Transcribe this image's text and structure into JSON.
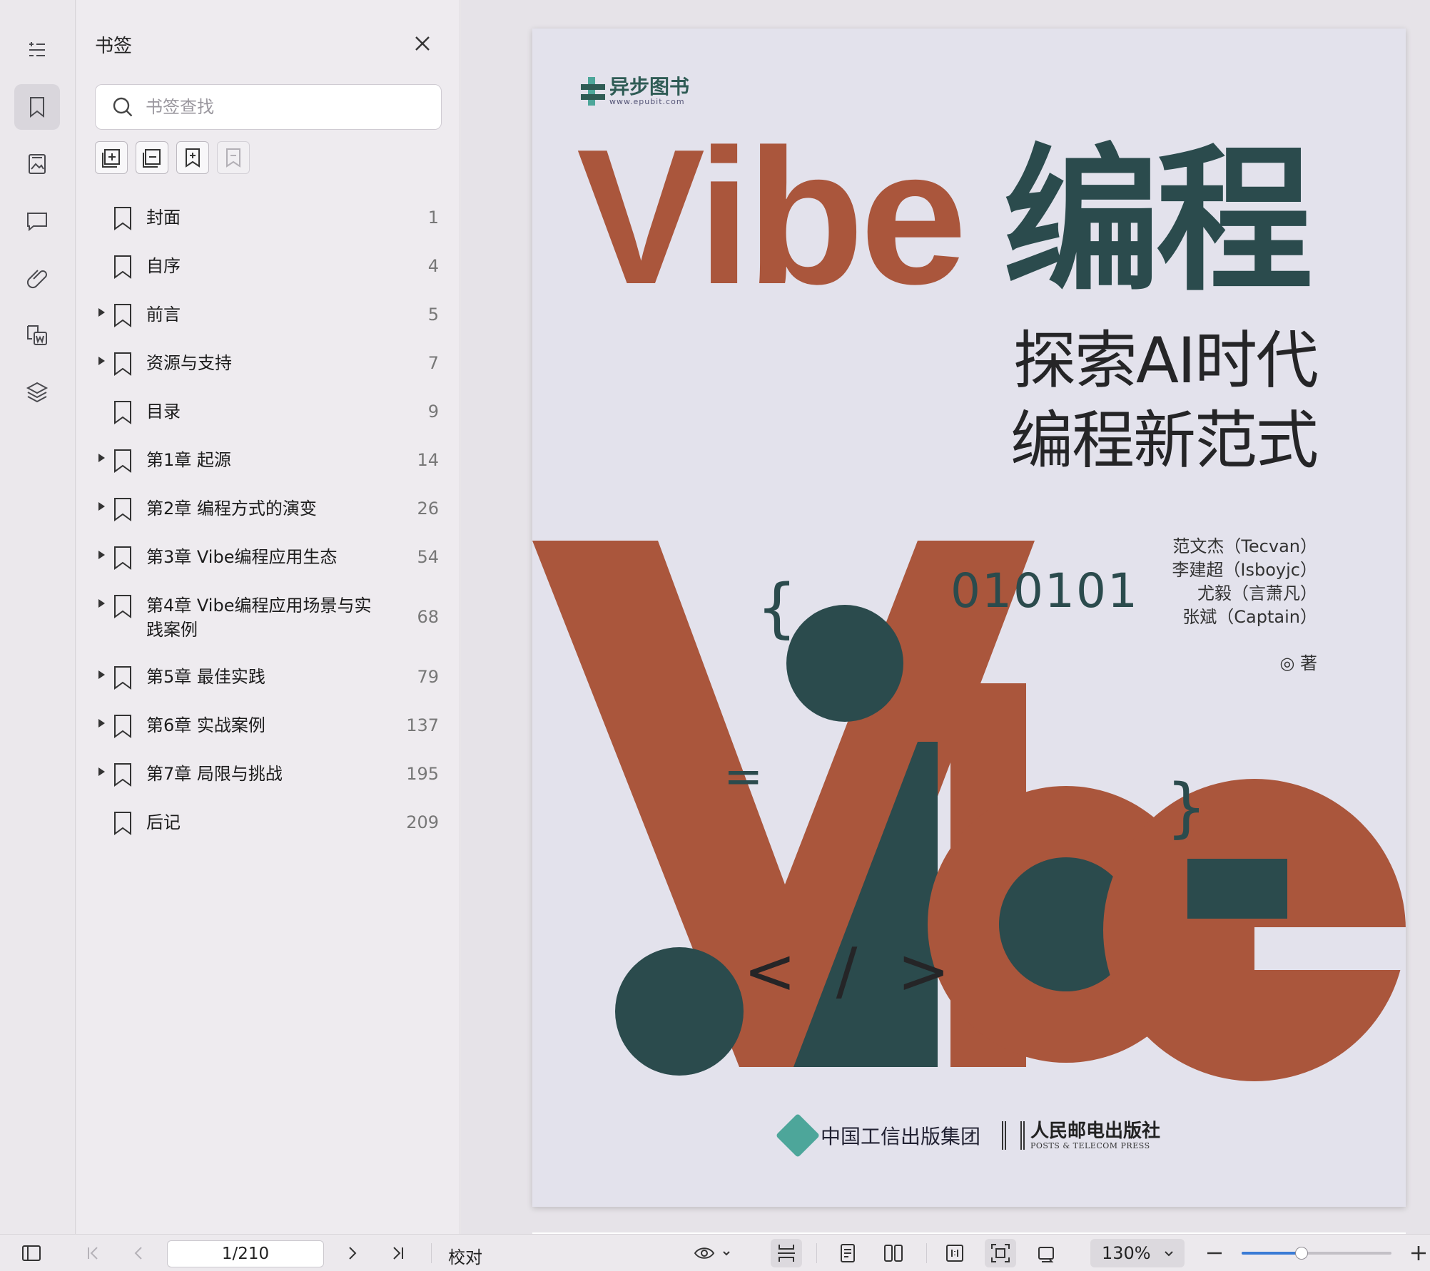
{
  "rail": {
    "items": [
      {
        "name": "outline-icon"
      },
      {
        "name": "bookmark-icon",
        "active": true
      },
      {
        "name": "thumbnail-icon"
      },
      {
        "name": "comment-icon"
      },
      {
        "name": "attachment-icon"
      },
      {
        "name": "pdf-to-word-icon"
      },
      {
        "name": "layers-icon"
      }
    ]
  },
  "bookmark_panel": {
    "title": "书签",
    "search_placeholder": "书签查找",
    "items": [
      {
        "label": "封面",
        "page": "1",
        "expandable": false
      },
      {
        "label": "自序",
        "page": "4",
        "expandable": false
      },
      {
        "label": "前言",
        "page": "5",
        "expandable": true
      },
      {
        "label": "资源与支持",
        "page": "7",
        "expandable": true
      },
      {
        "label": "目录",
        "page": "9",
        "expandable": false
      },
      {
        "label": "第1章 起源",
        "page": "14",
        "expandable": true
      },
      {
        "label": "第2章 编程方式的演变",
        "page": "26",
        "expandable": true
      },
      {
        "label": "第3章 Vibe编程应用生态",
        "page": "54",
        "expandable": true
      },
      {
        "label": "第4章 Vibe编程应用场景与实践案例",
        "page": "68",
        "expandable": true,
        "tall": true
      },
      {
        "label": "第5章 最佳实践",
        "page": "79",
        "expandable": true
      },
      {
        "label": "第6章 实战案例",
        "page": "137",
        "expandable": true
      },
      {
        "label": "第7章 局限与挑战",
        "page": "195",
        "expandable": true
      },
      {
        "label": "后记",
        "page": "209",
        "expandable": false
      }
    ]
  },
  "cover": {
    "publisher_logo": "异步图书",
    "publisher_url": "www.epubit.com",
    "title_latin": "Vibe",
    "title_cn": "编程",
    "subtitle_line1": "探索AI时代",
    "subtitle_line2": "编程新范式",
    "authors": [
      "范文杰（Tecvan）",
      "李建超（Isboyjc）",
      "尤毅（言萧凡）",
      "张斌（Captain）"
    ],
    "author_role": "◎ 著",
    "code_binary": "010101",
    "code_brace_open": "{",
    "code_brace_close": "}",
    "code_equals": "=",
    "code_tag": "< / >",
    "publisher1": "中国工信出版集团",
    "publisher2_cn": "人民邮电出版社",
    "publisher2_en": "POSTS & TELECOM PRESS",
    "colors": {
      "rust": "#aa563c",
      "teal": "#2b4b4d",
      "background": "#e3e2ec"
    }
  },
  "toolbar": {
    "page_value": "1/210",
    "proofread_label": "校对",
    "zoom_value": "130%",
    "zoom_slider_fraction": 0.4
  }
}
